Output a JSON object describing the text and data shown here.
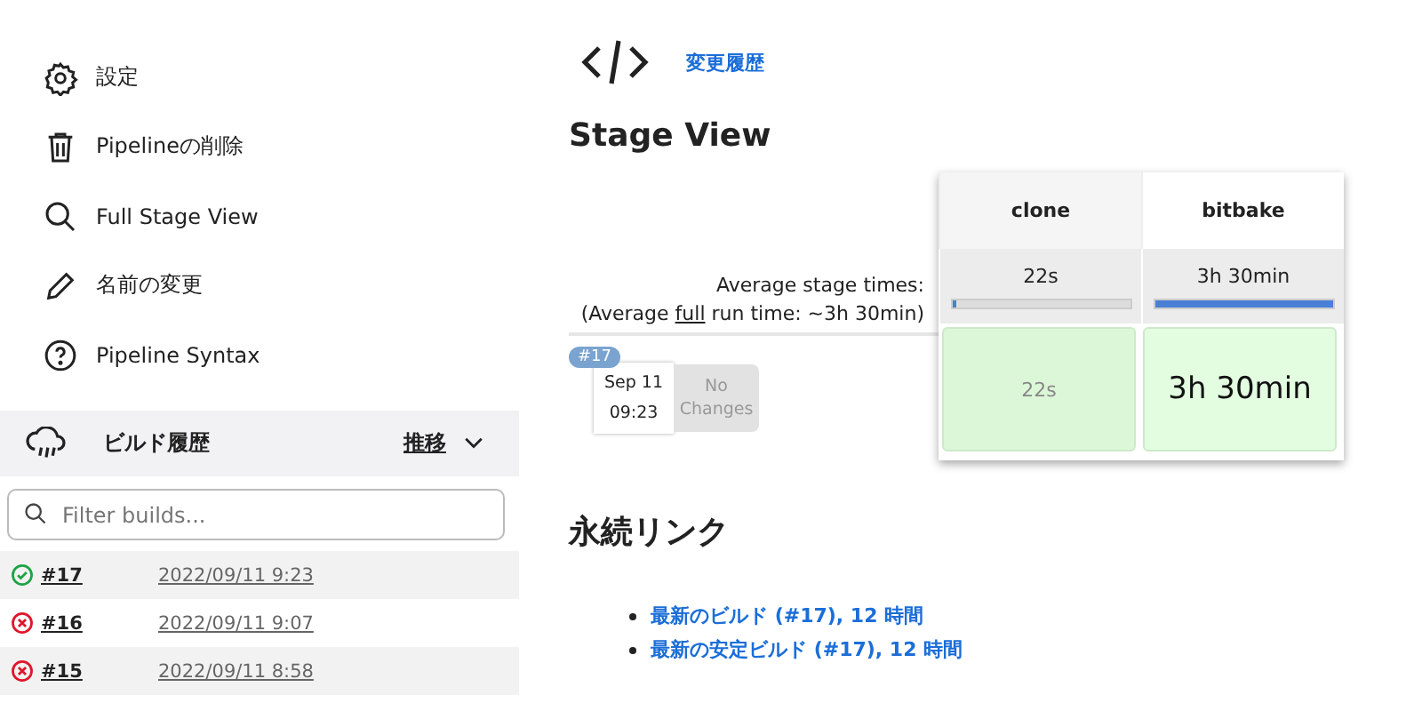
{
  "sidebar": {
    "items": [
      {
        "kind": "settings",
        "label": "設定"
      },
      {
        "kind": "delete",
        "label": "Pipelineの削除"
      },
      {
        "kind": "view",
        "label": "Full Stage View"
      },
      {
        "kind": "rename",
        "label": "名前の変更"
      },
      {
        "kind": "help",
        "label": "Pipeline Syntax"
      }
    ]
  },
  "build_history": {
    "title": "ビルド履歴",
    "trend": "推移",
    "filter": {
      "placeholder": "Filter builds..."
    },
    "builds": [
      {
        "kind": "success",
        "number": "#17",
        "time": "2022/09/11 9:23"
      },
      {
        "kind": "failure",
        "number": "#16",
        "time": "2022/09/11 9:07"
      },
      {
        "kind": "failure",
        "number": "#15",
        "time": "2022/09/11 8:58"
      }
    ]
  },
  "changes_link": "変更履歴",
  "stage_view": {
    "title": "Stage View",
    "avg_label": "Average stage times:",
    "avg_full": {
      "before": "(Average",
      "link": "full",
      "after": "run time: ~3h 30min)"
    },
    "stages": [
      {
        "name": "clone",
        "avg": "22s",
        "level": 0.02
      },
      {
        "name": "bitbake",
        "avg": "3h 30min",
        "level": 1.0
      }
    ],
    "runs": [
      {
        "badge": "#17",
        "date": "Sep 11",
        "time": "09:23",
        "changes": "No Changes",
        "cells": [
          {
            "text": "22s",
            "emphasis": false
          },
          {
            "text": "3h 30min",
            "emphasis": true
          }
        ]
      }
    ]
  },
  "permalinks": {
    "title": "永続リンク",
    "links": [
      "最新のビルド (#17), 12 時間",
      "最新の安定ビルド (#17), 12 時間"
    ]
  }
}
